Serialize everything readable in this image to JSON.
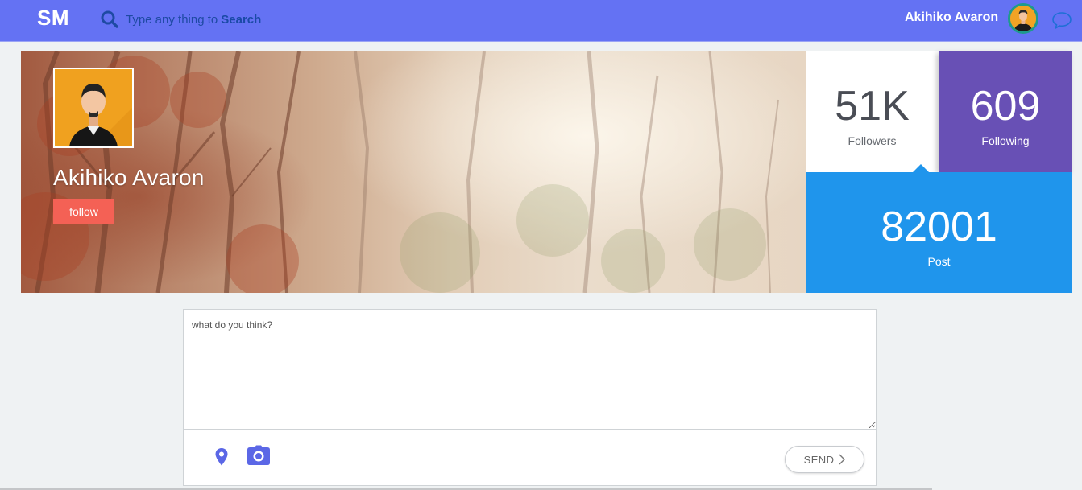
{
  "header": {
    "logo": "SM",
    "search": {
      "placeholder": "Type any thing to",
      "keyword": "Search",
      "icon": "search-icon"
    },
    "user_name": "Akihiko Avaron",
    "chat_icon": "chat-bubble-icon",
    "colors": {
      "bar": "#6472f3"
    }
  },
  "profile": {
    "name": "Akihiko Avaron",
    "follow_label": "follow"
  },
  "stats": {
    "followers": {
      "value": "51K",
      "label": "Followers"
    },
    "following": {
      "value": "609",
      "label": "Following"
    },
    "posts": {
      "value": "82001",
      "label": "Post"
    },
    "colors": {
      "following_bg": "#6850b5",
      "posts_bg": "#1f95ec",
      "follow_button": "#f46155"
    }
  },
  "composer": {
    "placeholder": "what do you think?",
    "location_icon": "map-pin-icon",
    "camera_icon": "camera-icon",
    "send_label": "SEND"
  }
}
